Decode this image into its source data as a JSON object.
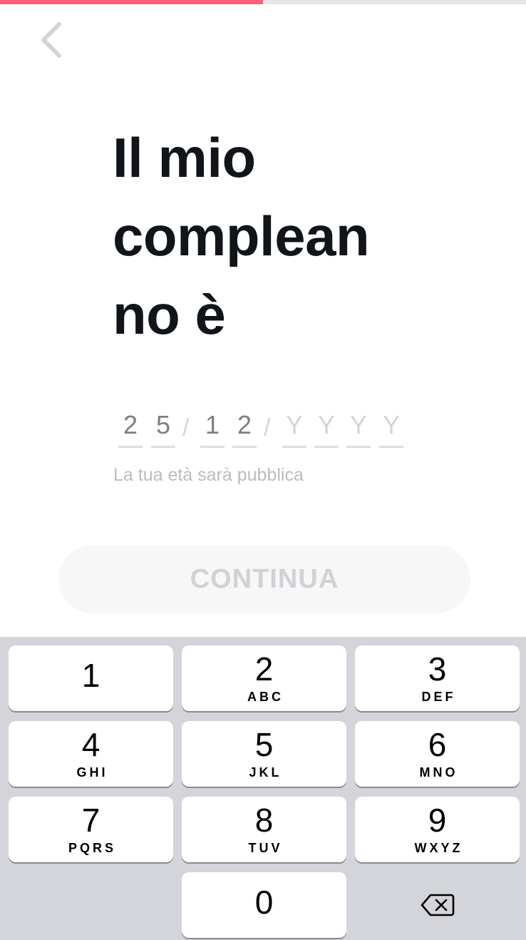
{
  "progress": {
    "fraction": 0.5,
    "color": "#fd5e78"
  },
  "header": {
    "back_icon": "chevron-left-icon"
  },
  "title": "Il mio\ncomplean\nno è",
  "date": {
    "day": [
      "2",
      "5"
    ],
    "month": [
      "1",
      "2"
    ],
    "year": [
      "Y",
      "Y",
      "Y",
      "Y"
    ],
    "separator": "/"
  },
  "hint": "La tua età sarà pubblica",
  "continue_label": "CONTINUA",
  "keypad": {
    "keys": [
      {
        "digit": "1",
        "letters": ""
      },
      {
        "digit": "2",
        "letters": "ABC"
      },
      {
        "digit": "3",
        "letters": "DEF"
      },
      {
        "digit": "4",
        "letters": "GHI"
      },
      {
        "digit": "5",
        "letters": "JKL"
      },
      {
        "digit": "6",
        "letters": "MNO"
      },
      {
        "digit": "7",
        "letters": "PQRS"
      },
      {
        "digit": "8",
        "letters": "TUV"
      },
      {
        "digit": "9",
        "letters": "WXYZ"
      },
      {
        "digit": "0",
        "letters": ""
      }
    ],
    "delete_icon": "backspace-icon"
  }
}
